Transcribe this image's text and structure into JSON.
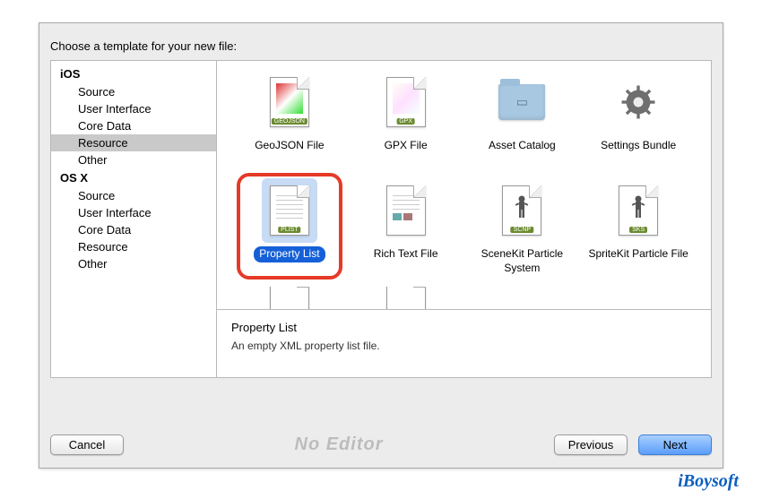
{
  "header": "Choose a template for your new file:",
  "sidebar": {
    "sections": [
      {
        "title": "iOS",
        "items": [
          "Source",
          "User Interface",
          "Core Data",
          "Resource",
          "Other"
        ],
        "selected_index": 3
      },
      {
        "title": "OS X",
        "items": [
          "Source",
          "User Interface",
          "Core Data",
          "Resource",
          "Other"
        ],
        "selected_index": -1
      }
    ]
  },
  "templates": [
    {
      "label": "GeoJSON File",
      "tag": "GEOJSON",
      "kind": "geojson"
    },
    {
      "label": "GPX File",
      "tag": "GPX",
      "kind": "gpx"
    },
    {
      "label": "Asset Catalog",
      "tag": "",
      "kind": "folder"
    },
    {
      "label": "Settings Bundle",
      "tag": "",
      "kind": "gear"
    },
    {
      "label": "Property List",
      "tag": "PLIST",
      "kind": "plist",
      "selected": true,
      "annotated": true
    },
    {
      "label": "Rich Text File",
      "tag": "",
      "kind": "rtf"
    },
    {
      "label": "SceneKit Particle System",
      "tag": "SCNP",
      "kind": "scnp"
    },
    {
      "label": "SpriteKit Particle File",
      "tag": "SKS",
      "kind": "sks"
    },
    {
      "label": "",
      "tag": "",
      "kind": "paper"
    },
    {
      "label": "",
      "tag": "",
      "kind": "paper"
    }
  ],
  "details": {
    "title": "Property List",
    "description": "An empty XML property list file."
  },
  "footer": {
    "cancel": "Cancel",
    "previous": "Previous",
    "next": "Next",
    "ghost": "No Editor"
  },
  "watermark": "iBoysoft"
}
